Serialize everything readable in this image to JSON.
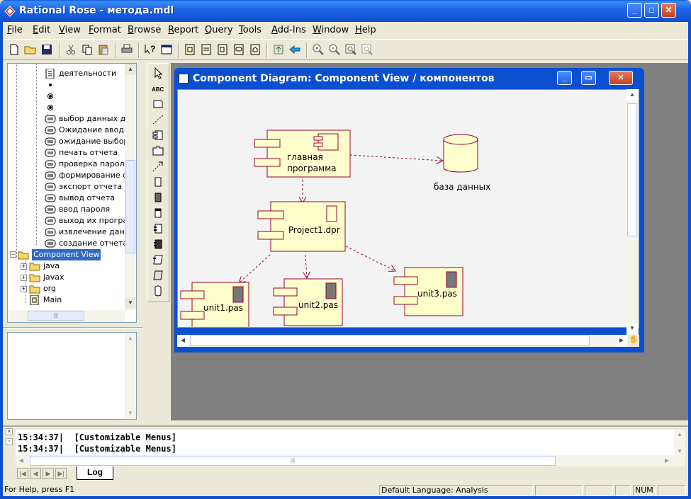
{
  "app": {
    "title": "Rational Rose - метода.mdl"
  },
  "menu": [
    "File",
    "Edit",
    "View",
    "Format",
    "Browse",
    "Report",
    "Query",
    "Tools",
    "Add-Ins",
    "Window",
    "Help"
  ],
  "browser": {
    "items": [
      {
        "label": "деятельности",
        "icon": "activity-diagram-icon"
      },
      {
        "label": "",
        "icon": "start-state-icon"
      },
      {
        "label": "",
        "icon": "end-state-icon"
      },
      {
        "label": "",
        "icon": "end-state-icon"
      },
      {
        "label": "выбор данных для",
        "icon": "activity-icon"
      },
      {
        "label": "Ожидание ввода п",
        "icon": "activity-icon"
      },
      {
        "label": "ожидание выбора",
        "icon": "activity-icon"
      },
      {
        "label": "печать отчета",
        "icon": "activity-icon"
      },
      {
        "label": "проверка пароля",
        "icon": "activity-icon"
      },
      {
        "label": "формирование от",
        "icon": "activity-icon"
      },
      {
        "label": "экспорт отчета",
        "icon": "activity-icon"
      },
      {
        "label": "вывод отчета",
        "icon": "activity-icon"
      },
      {
        "label": "ввод пароля",
        "icon": "activity-icon"
      },
      {
        "label": "выход их програм",
        "icon": "activity-icon"
      },
      {
        "label": "извлечение данны",
        "icon": "activity-icon"
      },
      {
        "label": "создание отчета",
        "icon": "activity-icon"
      }
    ],
    "component_view": "Component View",
    "packages": [
      "java",
      "javax",
      "org"
    ],
    "main": "Main"
  },
  "diagram_window": {
    "title": "Component Diagram: Component View / компонентов",
    "components": {
      "main_program_line1": "главная",
      "main_program_line2": "программа",
      "database": "база данных",
      "project": "Project1.dpr",
      "unit1": "unit1.pas",
      "unit2": "unit2.pas",
      "unit3": "unit3.pas"
    },
    "colors": {
      "fill": "#ffffcc",
      "stroke": "#990033",
      "dependency": "#990033"
    }
  },
  "log": {
    "lines": [
      {
        "time": "15:34:37|",
        "message": "[Customizable Menus]"
      },
      {
        "time": "15:34:37|",
        "message": "[Customizable Menus]"
      }
    ],
    "tab": "Log"
  },
  "status": {
    "help": "For Help, press F1",
    "language": "Default Language: Analysis",
    "num": "NUM"
  }
}
